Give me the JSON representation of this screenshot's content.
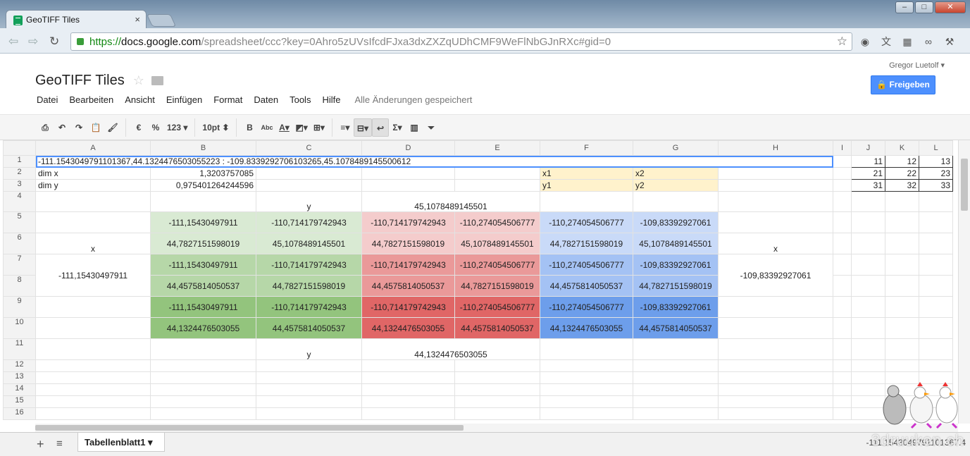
{
  "browser": {
    "tab_title": "GeoTIFF Tiles",
    "url_scheme": "https://",
    "url_host": "docs.google.com",
    "url_path": "/spreadsheet/ccc?key=0Ahro5zUVsIfcdFJxa3dxZXZqUDhCMF9WeFlNbGJnRXc#gid=0"
  },
  "doc": {
    "title": "GeoTIFF Tiles",
    "user": "Gregor Luetolf ▾",
    "share": "Freigeben",
    "menu": [
      "Datei",
      "Bearbeiten",
      "Ansicht",
      "Einfügen",
      "Format",
      "Daten",
      "Tools",
      "Hilfe"
    ],
    "status": "Alle Änderungen gespeichert"
  },
  "toolbar": {
    "euro": "€",
    "percent": "%",
    "num": "123 ▾",
    "fontsize": "10pt ⬍",
    "bold": "B",
    "strike": "Abc",
    "sigma": "Σ"
  },
  "columns": [
    "A",
    "B",
    "C",
    "D",
    "E",
    "F",
    "G",
    "H",
    "I",
    "J",
    "K",
    "L"
  ],
  "rows": [
    "1",
    "2",
    "3",
    "4",
    "5",
    "6",
    "7",
    "8",
    "9",
    "10",
    "11",
    "12",
    "13",
    "14",
    "15",
    "16"
  ],
  "cells": {
    "A1": "-111.1543049791101367,44.1324476503055223 : -109.8339292706103265,45.1078489145500612",
    "A2": "dim x",
    "B2": "1,3203757085",
    "F2": "x1",
    "G2": "x2",
    "A3": "dim y",
    "B3": "0,975401264244596",
    "F3": "y1",
    "G3": "y2",
    "C4": "y",
    "D4": "45,1078489145501",
    "B5": "-111,15430497911",
    "C5": "-110,714179742943",
    "D5": "-110,714179742943",
    "E5": "-110,274054506777",
    "F5": "-110,274054506777",
    "G5": "-109,83392927061",
    "A6": "x",
    "B6": "44,7827151598019",
    "C6": "45,1078489145501",
    "D6": "44,7827151598019",
    "E6": "45,1078489145501",
    "F6": "44,7827151598019",
    "G6": "45,1078489145501",
    "H6": "x",
    "A7": "-111,15430497911",
    "B7": "-111,15430497911",
    "C7": "-110,714179742943",
    "D7": "-110,714179742943",
    "E7": "-110,274054506777",
    "F7": "-110,274054506777",
    "G7": "-109,83392927061",
    "H7": "-109,83392927061",
    "B8": "44,4575814050537",
    "C8": "44,7827151598019",
    "D8": "44,4575814050537",
    "E8": "44,7827151598019",
    "F8": "44,4575814050537",
    "G8": "44,7827151598019",
    "B9": "-111,15430497911",
    "C9": "-110,714179742943",
    "D9": "-110,714179742943",
    "E9": "-110,274054506777",
    "F9": "-110,274054506777",
    "G9": "-109,83392927061",
    "B10": "44,1324476503055",
    "C10": "44,4575814050537",
    "D10": "44,1324476503055",
    "E10": "44,4575814050537",
    "F10": "44,1324476503055",
    "G10": "44,4575814050537",
    "C11": "y",
    "D11": "44,1324476503055",
    "J1": "11",
    "K1": "12",
    "L1": "13",
    "J2": "21",
    "K2": "22",
    "L2": "23",
    "J3": "31",
    "K3": "32",
    "L3": "33"
  },
  "footer": {
    "add": "+",
    "list": "≡",
    "sheet": "Tabellenblatt1 ▾",
    "sum": "-111.1543049791101367.4"
  },
  "watermark": "3druuken.ch"
}
